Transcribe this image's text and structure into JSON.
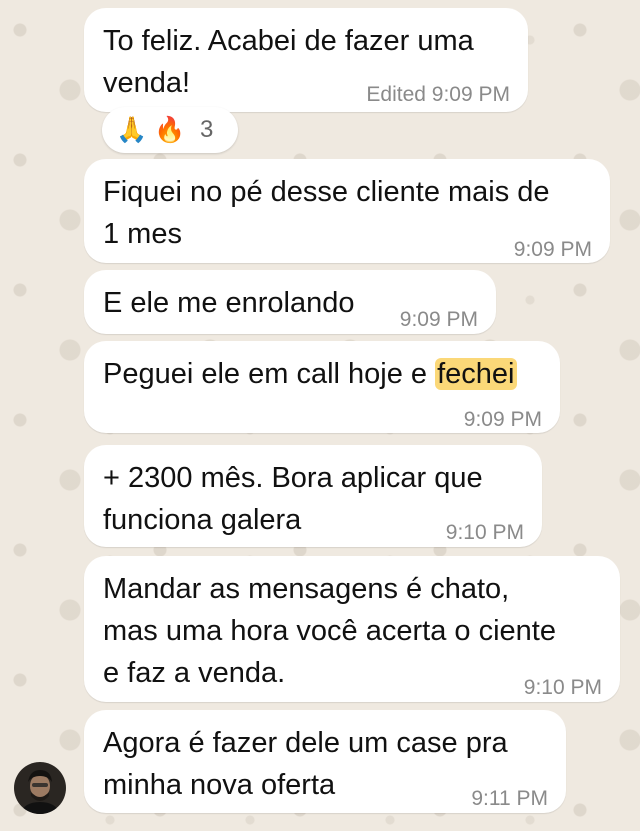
{
  "chat": {
    "messages": [
      {
        "lines": [
          "To feliz. Acabei de fazer uma",
          "venda!"
        ],
        "edited_label": "Edited",
        "time": "9:09 PM"
      },
      {
        "lines": [
          "Fiquei no pé desse cliente mais de",
          "1 mes"
        ],
        "time": "9:09 PM"
      },
      {
        "lines": [
          "E ele me enrolando"
        ],
        "time": "9:09 PM"
      },
      {
        "text_before": "Peguei ele em call hoje e ",
        "highlight": "fechei",
        "time": "9:09 PM"
      },
      {
        "lines": [
          "+ 2300 mês. Bora aplicar que",
          "funciona galera"
        ],
        "time": "9:10 PM"
      },
      {
        "lines": [
          "Mandar as mensagens é chato,",
          "mas uma hora você acerta o ciente",
          "e faz a venda."
        ],
        "time": "9:10 PM"
      },
      {
        "lines": [
          "Agora é fazer dele um case pra",
          "minha nova oferta"
        ],
        "time": "9:11 PM"
      }
    ],
    "reactions": {
      "emojis": [
        "🙏",
        "🔥"
      ],
      "emoji_names": [
        "folded-hands-emoji",
        "fire-emoji"
      ],
      "count": "3"
    },
    "sender_avatar": "avatar-icon"
  },
  "colors": {
    "bubble": "#ffffff",
    "wallpaper": "#efe9e0",
    "highlight": "#fbd878",
    "meta_text": "#8a8a8a"
  }
}
